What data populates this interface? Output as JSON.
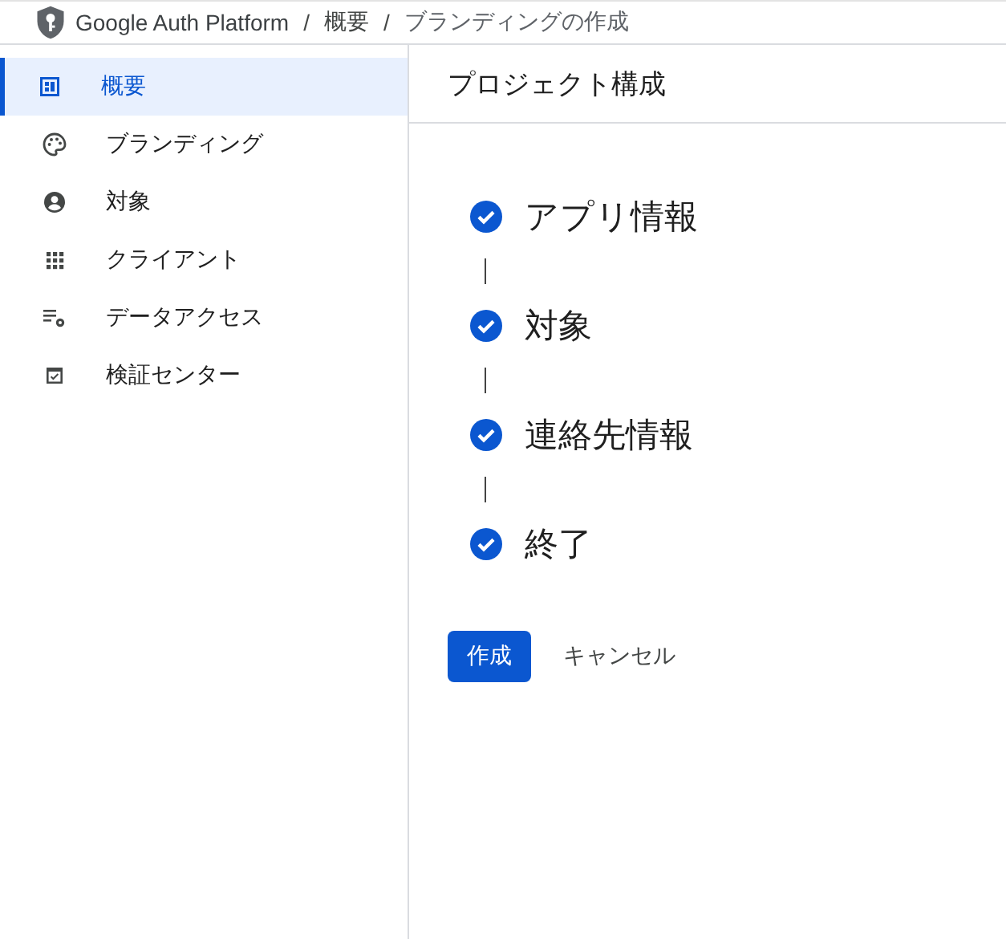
{
  "breadcrumb": [
    {
      "text": "Google Auth Platform",
      "kind": "product"
    },
    {
      "text": "/",
      "kind": "separator"
    },
    {
      "text": "概要",
      "kind": "link"
    },
    {
      "text": "/",
      "kind": "separator"
    },
    {
      "text": "ブランディングの作成",
      "kind": "current"
    }
  ],
  "sidebar": {
    "items": [
      {
        "label": "概要",
        "kind": "dashboard",
        "selected": true
      },
      {
        "label": "ブランディング",
        "kind": "palette",
        "selected": false
      },
      {
        "label": "対象",
        "kind": "person",
        "selected": false
      },
      {
        "label": "クライアント",
        "kind": "grid",
        "selected": false
      },
      {
        "label": "データアクセス",
        "kind": "listgear",
        "selected": false
      },
      {
        "label": "検証センター",
        "kind": "checkbox",
        "selected": false
      }
    ]
  },
  "main": {
    "title": "プロジェクト構成",
    "steps": [
      {
        "label": "アプリ情報",
        "done": true
      },
      {
        "label": "対象",
        "done": true
      },
      {
        "label": "連絡先情報",
        "done": true
      },
      {
        "label": "終了",
        "done": true
      }
    ],
    "buttons": [
      {
        "label": "作成",
        "kind": "primary"
      },
      {
        "label": "キャンセル",
        "kind": "text"
      }
    ]
  }
}
